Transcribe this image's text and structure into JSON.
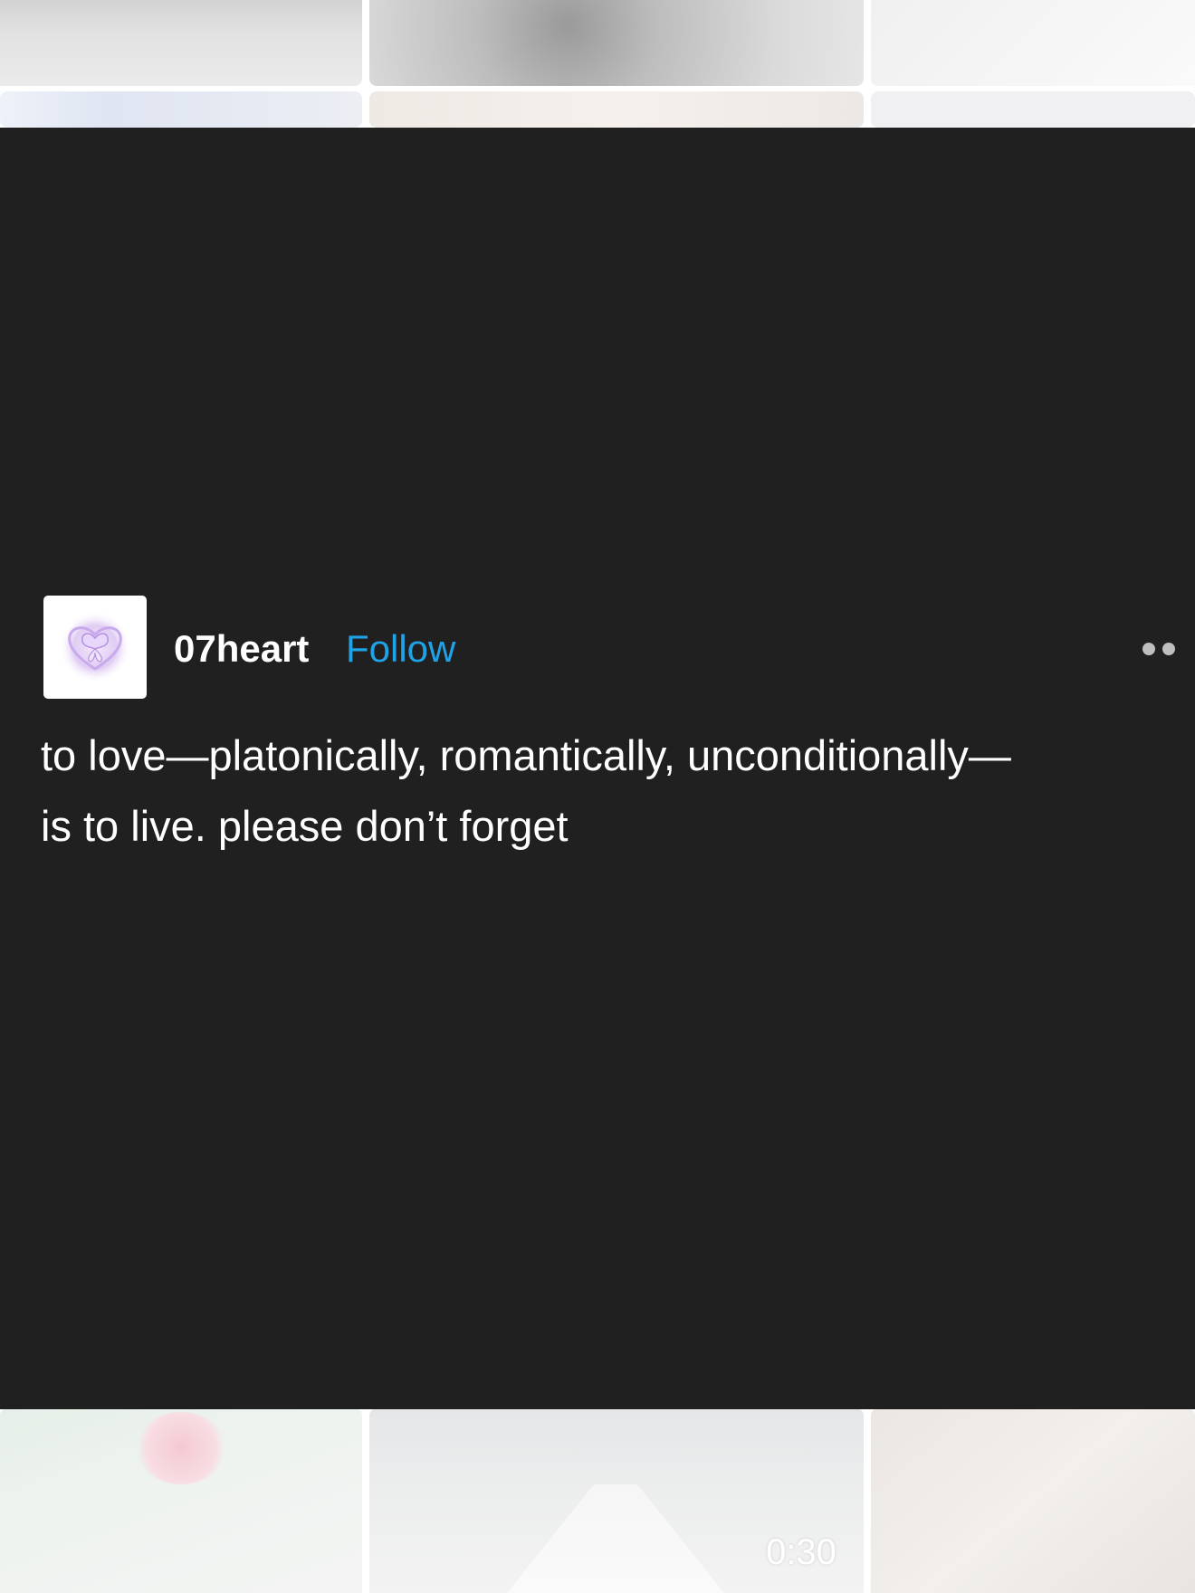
{
  "post": {
    "author": "07heart",
    "follow_label": "Follow",
    "text_lines": [
      "to love—platonically, romantically, unconditionally—",
      "is to live. please don’t forget"
    ]
  },
  "icons": {
    "avatar": "butterfly-heart-avatar-icon",
    "more": "more-options-icon"
  },
  "background_grid": {
    "video_duration": "0:30"
  },
  "colors": {
    "post_background": "#202021",
    "follow_accent": "#1fa2e6",
    "text": "#ffffff"
  }
}
